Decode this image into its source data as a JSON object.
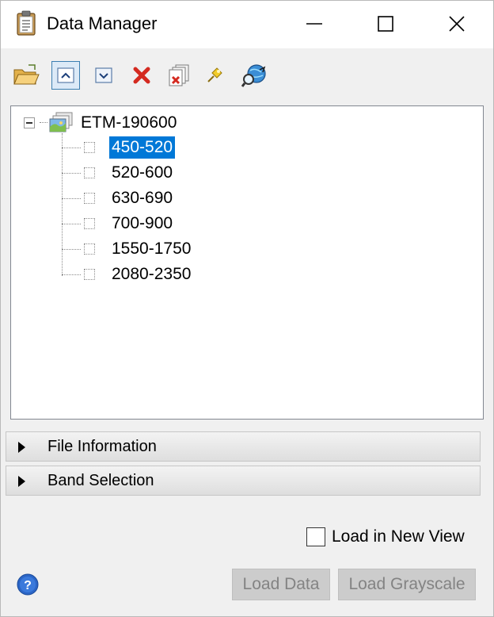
{
  "window": {
    "title": "Data Manager",
    "title_icon": "clipboard-icon",
    "controls": [
      "minimize-icon",
      "maximize-icon",
      "close-icon"
    ]
  },
  "toolbar": {
    "buttons": [
      {
        "name": "open-file-button",
        "icon": "folder-open-icon"
      },
      {
        "name": "collapse-all-button",
        "icon": "chevron-up-icon",
        "active": true
      },
      {
        "name": "expand-all-button",
        "icon": "chevron-down-icon"
      },
      {
        "name": "remove-button",
        "icon": "red-x-icon"
      },
      {
        "name": "remove-all-button",
        "icon": "close-files-icon"
      },
      {
        "name": "pin-button",
        "icon": "pin-icon"
      },
      {
        "name": "search-data-button",
        "icon": "globe-search-icon"
      }
    ]
  },
  "tree": {
    "root": {
      "label": "ETM-190600",
      "expanded": true
    },
    "items": [
      {
        "label": "450-520",
        "selected": true
      },
      {
        "label": "520-600",
        "selected": false
      },
      {
        "label": "630-690",
        "selected": false
      },
      {
        "label": "700-900",
        "selected": false
      },
      {
        "label": "1550-1750",
        "selected": false
      },
      {
        "label": "2080-2350",
        "selected": false
      }
    ]
  },
  "sections": [
    {
      "label": "File Information",
      "expanded": false
    },
    {
      "label": "Band Selection",
      "expanded": false
    }
  ],
  "options": {
    "load_in_new_view_label": "Load in New View",
    "load_in_new_view_checked": false
  },
  "buttons": {
    "load_data": "Load Data",
    "load_grayscale": "Load Grayscale"
  },
  "colors": {
    "selection": "#0078d7",
    "help_blue": "#2b65c6",
    "remove_red": "#d42a20"
  }
}
